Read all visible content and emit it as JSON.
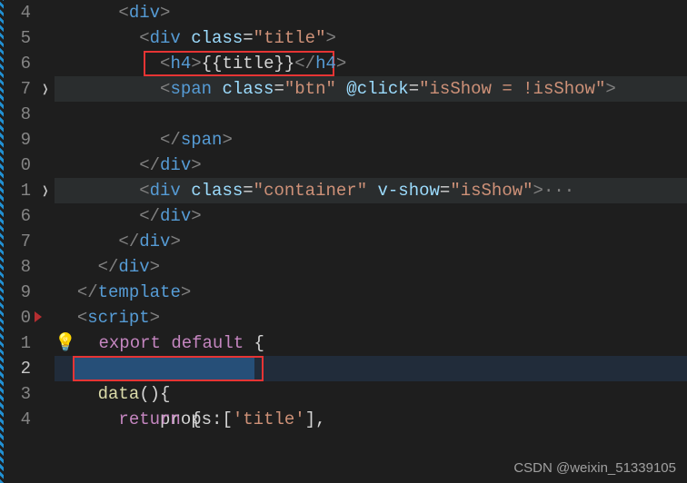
{
  "watermark": "CSDN @weixin_51339105",
  "gutter": {
    "lines": [
      "4",
      "5",
      "6",
      "7",
      "8",
      "9",
      "0",
      "1",
      "6",
      "7",
      "8",
      "9",
      "0",
      "1",
      "2",
      "3",
      "4"
    ],
    "foldable": [
      false,
      false,
      false,
      true,
      false,
      false,
      false,
      true,
      false,
      false,
      false,
      false,
      false,
      false,
      false,
      false,
      false
    ],
    "redMarks": [
      false,
      false,
      false,
      false,
      false,
      false,
      false,
      false,
      false,
      false,
      false,
      false,
      true,
      false,
      false,
      false,
      false
    ]
  },
  "code": {
    "div_open": "div",
    "div_close": "div",
    "span_open": "span",
    "span_close": "span",
    "h4_open": "h4",
    "h4_close": "h4",
    "template_close": "template",
    "script_open": "script",
    "class_attr": "class",
    "click_attr": "@click",
    "vshow_attr": "v-show",
    "title_val": "\"title\"",
    "btn_val": "\"btn\"",
    "container_val": "\"container\"",
    "isshow_eq": "\"isShow = !isShow\"",
    "isshow_val": "\"isShow\"",
    "mustache": "{{title}}",
    "export": "export",
    "default": "default",
    "brace_open": "{",
    "brace_close": "}",
    "props_line": "props:",
    "props_arr_open": "[",
    "props_str": "'title'",
    "props_arr_close": "]",
    "comma": ",",
    "data_fn": "data",
    "parens": "()",
    "return": "return",
    "dots": "···"
  }
}
